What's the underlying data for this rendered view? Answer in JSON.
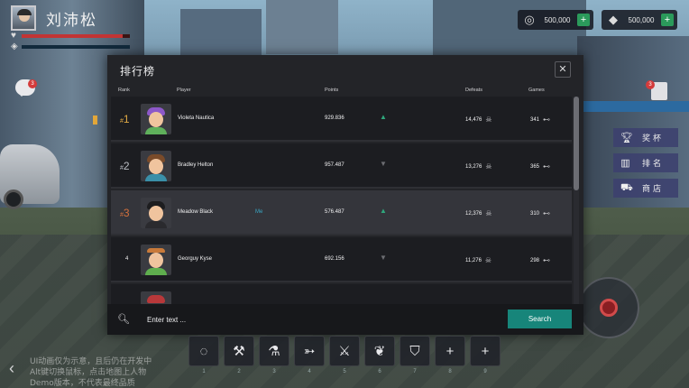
{
  "player": {
    "name": "刘沛松",
    "hp_fraction": 0.93,
    "mp_fraction": 0.0
  },
  "currencies": [
    {
      "icon": "coin-icon",
      "value": "500,000",
      "add": "+"
    },
    {
      "icon": "diamond-icon",
      "value": "500,000",
      "add": "+"
    }
  ],
  "notifications": {
    "chat_count": "3",
    "quest_count": "3"
  },
  "side_menu": [
    {
      "icon": "trophy-icon",
      "label": "奖杯"
    },
    {
      "icon": "bar-chart-icon",
      "label": "排名"
    },
    {
      "icon": "cart-icon",
      "label": "商店"
    }
  ],
  "leaderboard": {
    "title": "排行榜",
    "close": "✕",
    "columns": {
      "rank": "Rank",
      "player": "Player",
      "points": "Points",
      "defeats": "Defeats",
      "games": "Games"
    },
    "rows": [
      {
        "rank": "1",
        "rank_prefix": "#",
        "name": "Violeta Nautica",
        "tag": "",
        "points": "929.836",
        "trend": "up",
        "defeats": "14,476",
        "games": "341"
      },
      {
        "rank": "2",
        "rank_prefix": "#",
        "name": "Bradley Helton",
        "tag": "",
        "points": "957.487",
        "trend": "down",
        "defeats": "13,276",
        "games": "365"
      },
      {
        "rank": "3",
        "rank_prefix": "#",
        "name": "Meadow Black",
        "tag": "Me",
        "points": "576.487",
        "trend": "up",
        "defeats": "12,376",
        "games": "310"
      },
      {
        "rank": "4",
        "rank_prefix": "",
        "name": "Georguy Kyse",
        "tag": "",
        "points": "692.156",
        "trend": "down",
        "defeats": "11,276",
        "games": "298"
      }
    ],
    "search": {
      "placeholder": "Enter text ...",
      "button": "Search"
    }
  },
  "dock": [
    {
      "icon": "ring-icon",
      "num": "1"
    },
    {
      "icon": "wrench-icon",
      "num": "2"
    },
    {
      "icon": "potion-icon",
      "num": "3"
    },
    {
      "icon": "arrow-icon",
      "num": "4"
    },
    {
      "icon": "axe-icon",
      "num": "5"
    },
    {
      "icon": "leaf-icon",
      "num": "6"
    },
    {
      "icon": "shield-icon",
      "num": "7"
    },
    {
      "icon": "plus-icon",
      "num": "8"
    },
    {
      "icon": "plus-icon",
      "num": "9"
    }
  ],
  "hint_lines": [
    "UI动画仅为示意，且后仍在开发中",
    "Alt键切换鼠标，点击地图上人物",
    "Demo版本，不代表最终品质"
  ],
  "colors": {
    "accent": "#17857a",
    "gold": "#e0aa45",
    "trend_up": "#2fa77c",
    "me_tag": "#39a6c4"
  }
}
